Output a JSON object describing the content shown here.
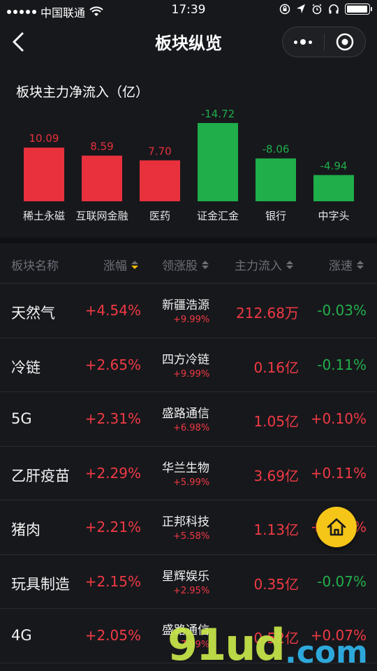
{
  "status_bar": {
    "carrier": "中国联通",
    "time": "17:39",
    "battery_level": 0.95
  },
  "nav": {
    "title": "板块纵览"
  },
  "chart_data": {
    "type": "bar",
    "title": "板块主力净流入（亿）",
    "categories": [
      "稀土永磁",
      "互联网金融",
      "医药",
      "证金汇金",
      "银行",
      "中字头"
    ],
    "values": [
      10.09,
      8.59,
      7.7,
      -14.72,
      -8.06,
      -4.94
    ],
    "value_labels": [
      "10.09",
      "8.59",
      "7.70",
      "-14.72",
      "-8.06",
      "-4.94"
    ],
    "colors": {
      "positive": "#e8313d",
      "negative": "#1fae4a"
    },
    "xlabel": "",
    "ylabel": "",
    "grid": false
  },
  "table": {
    "headers": {
      "name": "板块名称",
      "change": "涨幅",
      "leader": "领涨股",
      "inflow": "主力流入",
      "speed": "涨速"
    },
    "rows": [
      {
        "name": "天然气",
        "change": "+4.54%",
        "leader": "新疆浩源",
        "leader_change": "+9.99%",
        "inflow": "212.68万",
        "speed": "-0.03%",
        "speed_dir": "down"
      },
      {
        "name": "冷链",
        "change": "+2.65%",
        "leader": "四方冷链",
        "leader_change": "+9.99%",
        "inflow": "0.16亿",
        "speed": "-0.11%",
        "speed_dir": "down"
      },
      {
        "name": "5G",
        "change": "+2.31%",
        "leader": "盛路通信",
        "leader_change": "+6.98%",
        "inflow": "1.05亿",
        "speed": "+0.10%",
        "speed_dir": "up"
      },
      {
        "name": "乙肝疫苗",
        "change": "+2.29%",
        "leader": "华兰生物",
        "leader_change": "+5.99%",
        "inflow": "3.69亿",
        "speed": "+0.11%",
        "speed_dir": "up"
      },
      {
        "name": "猪肉",
        "change": "+2.21%",
        "leader": "正邦科技",
        "leader_change": "+5.58%",
        "inflow": "1.13亿",
        "speed": "+0.15%",
        "speed_dir": "up"
      },
      {
        "name": "玩具制造",
        "change": "+2.15%",
        "leader": "星辉娱乐",
        "leader_change": "+2.95%",
        "inflow": "0.35亿",
        "speed": "-0.07%",
        "speed_dir": "down"
      },
      {
        "name": "4G",
        "change": "+2.05%",
        "leader": "盛路通信",
        "leader_change": "+7.09%",
        "inflow": "0.52亿",
        "speed": "+0.07%",
        "speed_dir": "up"
      }
    ]
  },
  "watermark": {
    "main": "91ud",
    "suffix": ".com"
  },
  "colors": {
    "background": "#17181c",
    "up": "#f03a44",
    "down": "#23b04c",
    "accent": "#f5c518"
  }
}
